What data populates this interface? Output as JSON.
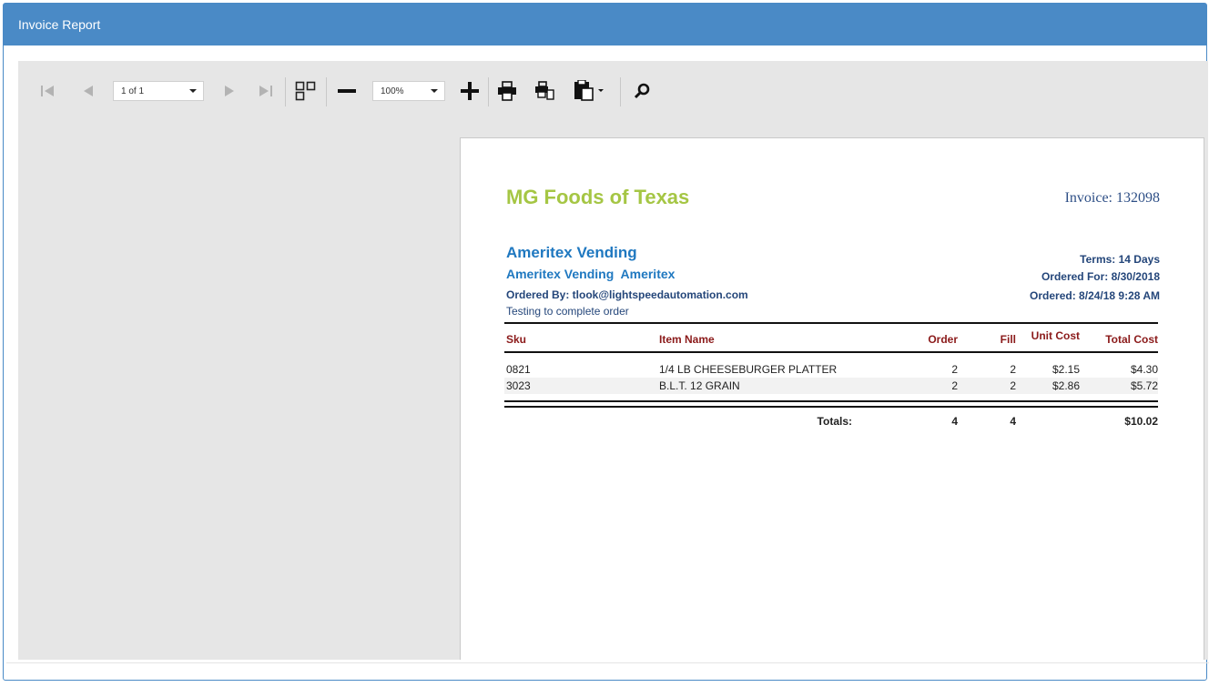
{
  "panel": {
    "title": "Invoice Report"
  },
  "toolbar": {
    "page_select": {
      "value": "1 of 1"
    },
    "zoom_select": {
      "value": "100%"
    },
    "icons": [
      "first-page-icon",
      "prev-page-icon",
      "next-page-icon",
      "last-page-icon",
      "multipage-icon",
      "zoom-out-icon",
      "zoom-in-icon",
      "print-icon",
      "print-page-icon",
      "export-icon",
      "search-icon"
    ]
  },
  "report": {
    "company": "MG Foods of Texas",
    "invoice": "Invoice: 132098",
    "customer_name": "Ameritex Vending",
    "customer_line2": "Ameritex Vending  Ameritex",
    "ordered_by": "Ordered By: tlook@lightspeedautomation.com",
    "note": "Testing to complete order",
    "terms": "Terms: 14 Days",
    "ordered_for": "Ordered For: 8/30/2018",
    "ordered_at": "Ordered: 8/24/18 9:28 AM",
    "columns": {
      "sku": "Sku",
      "item": "Item Name",
      "order": "Order",
      "fill": "Fill",
      "unit": "Unit Cost",
      "total": "Total Cost"
    },
    "rows": [
      {
        "sku": "0821",
        "item": "1/4 LB CHEESEBURGER PLATTER",
        "order": "2",
        "fill": "2",
        "unit": "$2.15",
        "total": "$4.30"
      },
      {
        "sku": "3023",
        "item": "B.L.T. 12 GRAIN",
        "order": "2",
        "fill": "2",
        "unit": "$2.86",
        "total": "$5.72"
      }
    ],
    "totals": {
      "label": "Totals:",
      "order": "4",
      "fill": "4",
      "total": "$10.02"
    }
  },
  "colors": {
    "header": "#4a8ac6",
    "company": "#a5c644",
    "customer": "#1f78c0",
    "column_header": "#8b1a1a",
    "meta": "#24467a"
  }
}
